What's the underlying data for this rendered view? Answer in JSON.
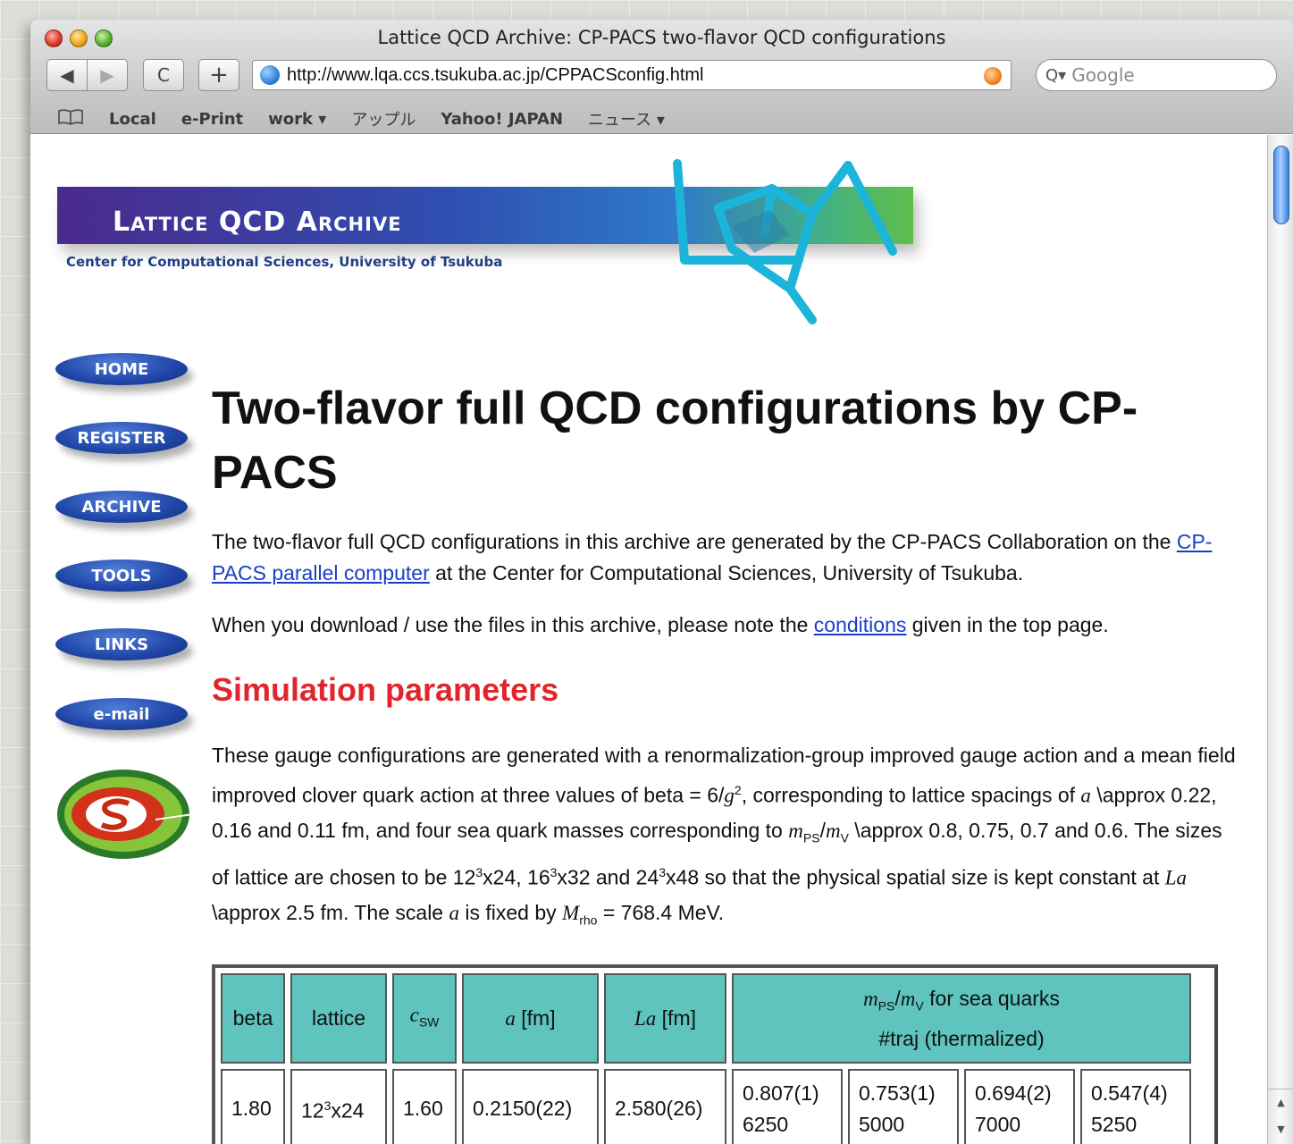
{
  "window": {
    "title": "Lattice QCD Archive: CP-PACS two-flavor QCD configurations"
  },
  "toolbar": {
    "back_glyph": "◀",
    "forward_glyph": "▶",
    "reload_glyph": "C",
    "add_glyph": "+",
    "url": "http://www.lqa.ccs.tsukuba.ac.jp/CPPACSconfig.html",
    "search_placeholder": "Google",
    "search_glyph": "Q▾"
  },
  "bookmarks": {
    "icon": "book-icon",
    "items": [
      "Local",
      "e-Print",
      "work ▾",
      "アップル",
      "Yahoo! JAPAN",
      "ニュース ▾"
    ]
  },
  "banner": {
    "title": "Lattice QCD Archive",
    "subtitle": "Center for Computational Sciences, University of Tsukuba",
    "logo_icon": "lqa-logo-icon"
  },
  "nav": {
    "home": "HOME",
    "register": "REGISTER",
    "archive": "ARCHIVE",
    "tools": "TOOLS",
    "links": "LINKS",
    "email": "e-mail"
  },
  "page": {
    "title": "Two-flavor full QCD configurations by CP-PACS",
    "intro_before": "The two-flavor full QCD configurations in this archive are generated by the CP-PACS Collaboration on the ",
    "intro_link": "CP-PACS parallel computer",
    "intro_after": " at the Center for Computational Sciences, University of Tsukuba.",
    "note_before": "When you download / use the files in this archive, please note the ",
    "note_link": "conditions",
    "note_after": " given in the top page.",
    "section_title": "Simulation parameters",
    "sim_1": "These gauge configurations are generated with a renormalization-group improved gauge action and a mean field improved clover quark action at three values of beta = 6/",
    "sim_g": "g",
    "sim_2": ", corresponding to lattice spacings of ",
    "sim_a": "a",
    "sim_3": " \\approx 0.22, 0.16 and 0.11 fm, and four sea quark masses corresponding to ",
    "sim_m": "m",
    "sim_ps": "PS",
    "sim_slash": "/",
    "sim_mv": "m",
    "sim_v": "V",
    "sim_4": " \\approx 0.8, 0.75, 0.7 and 0.6. The sizes of lattice are chosen to be 12",
    "sim_5": "x24, 16",
    "sim_6": "x32 and 24",
    "sim_7": "x48 so that the physical spatial size is kept constant at ",
    "sim_la": "La",
    "sim_8": " \\approx 2.5 fm. The scale ",
    "sim_a2": "a",
    "sim_9": " is fixed by ",
    "sim_M": "M",
    "sim_rho": "rho",
    "sim_10": " = 768.4 MeV.",
    "sup2": "2",
    "sup3": "3"
  },
  "table": {
    "headers": {
      "beta": "beta",
      "lattice": "lattice",
      "csw_c": "c",
      "csw_sub": "SW",
      "a": "a",
      "a_unit": " [fm]",
      "la": "La",
      "la_unit": " [fm]",
      "mps_m": "m",
      "mps_ps": "PS",
      "mps_slash": "/",
      "mps_m2": "m",
      "mps_v": "V",
      "mps_rest": " for sea quarks",
      "traj": "#traj (thermalized)"
    },
    "row1": {
      "beta": "1.80",
      "lattice_base": "12",
      "lattice_exp": "3",
      "lattice_rest": "x24",
      "csw": "1.60",
      "a": "0.2150(22)",
      "la": "2.580(26)",
      "v1": "0.807(1)",
      "t1": "6250",
      "v2": "0.753(1)",
      "t2": "5000",
      "v3": "0.694(2)",
      "t3": "7000",
      "v4": "0.547(4)",
      "t4": "5250"
    }
  }
}
